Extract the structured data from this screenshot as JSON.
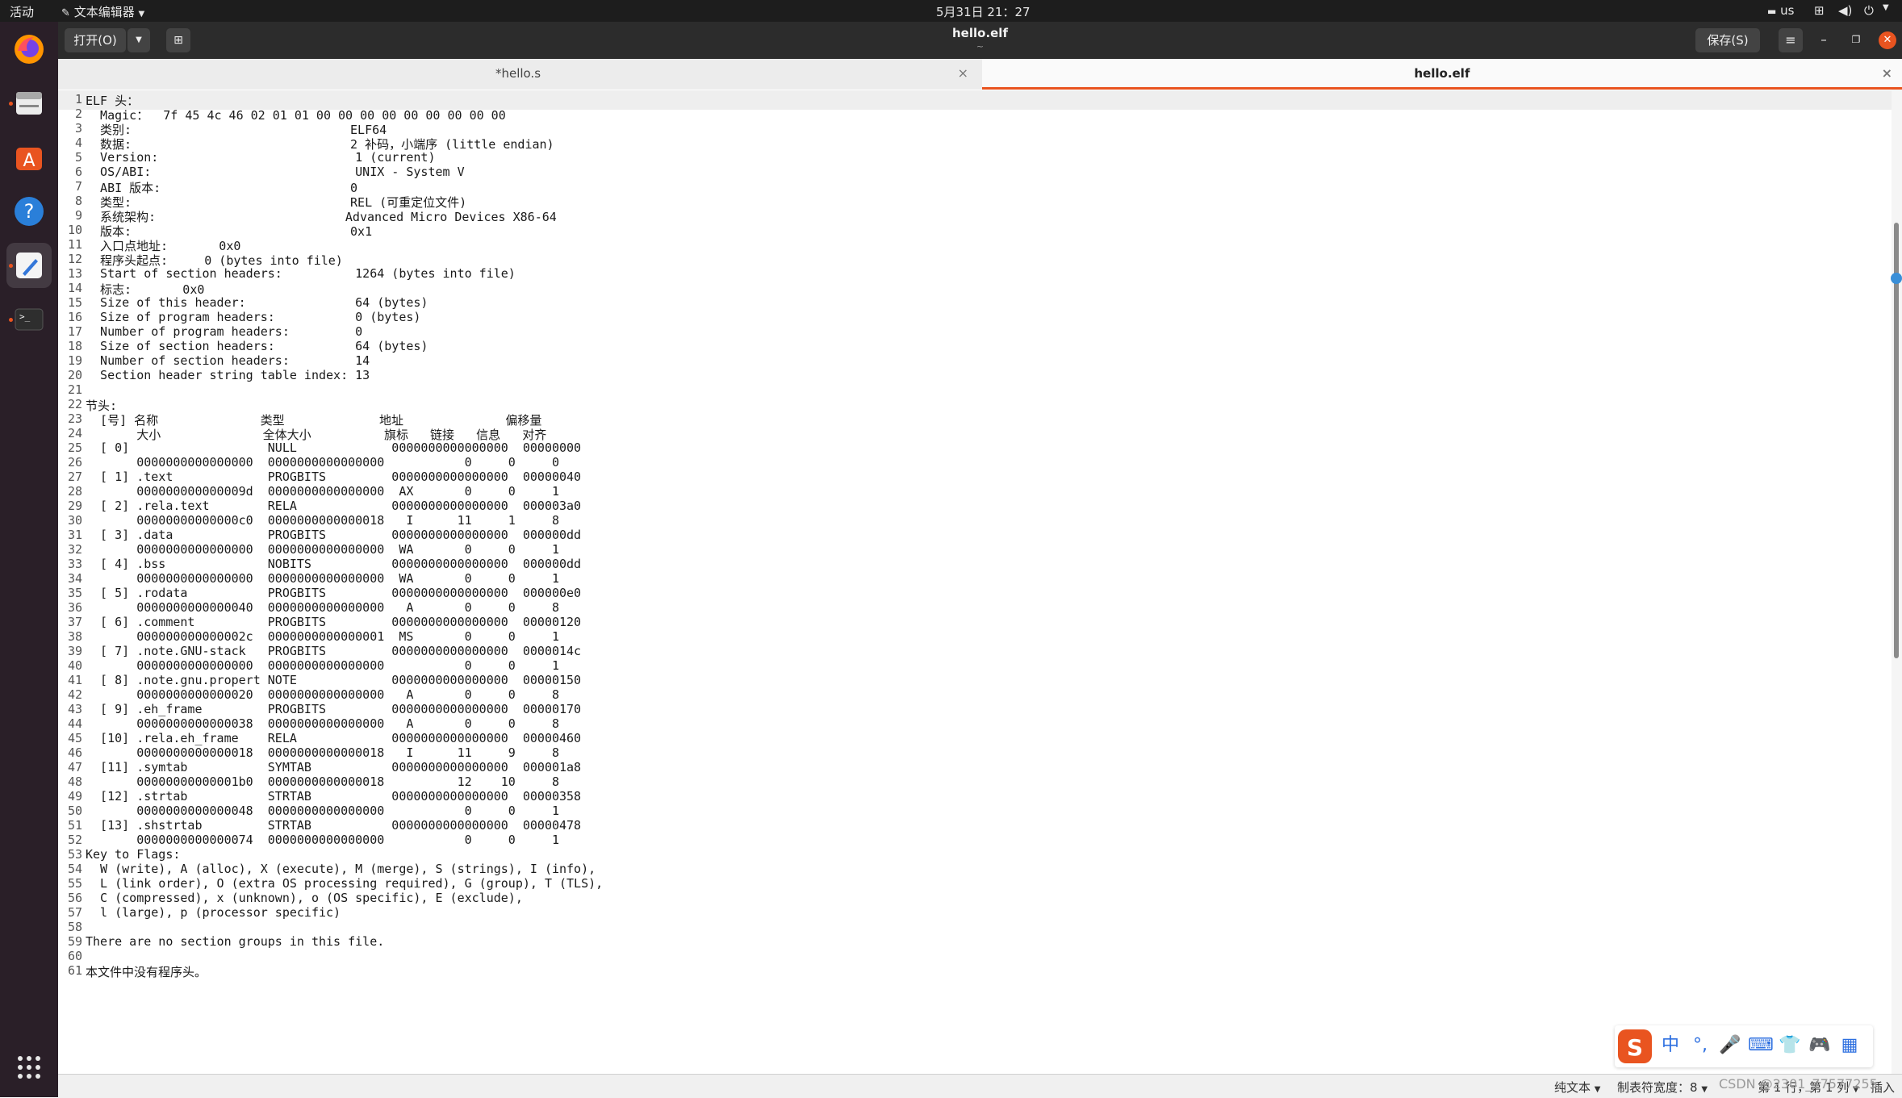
{
  "topbar": {
    "activities": "活动",
    "app_menu": "文本编辑器",
    "clock": "5月31日  21：27",
    "keyboard": "us"
  },
  "headerbar": {
    "open_label": "打开(O)",
    "title": "hello.elf",
    "subtitle": "~",
    "save_label": "保存(S)"
  },
  "tabs": [
    {
      "label": "*hello.s",
      "close": "×"
    },
    {
      "label": "hello.elf",
      "close": "×"
    }
  ],
  "editor": {
    "lines": [
      {
        "n": "1",
        "t": "ELF 头："
      },
      {
        "n": "2",
        "t": "  Magic：  7f 45 4c 46 02 01 01 00 00 00 00 00 00 00 00 00"
      },
      {
        "n": "3",
        "t": "  类别:                              ELF64"
      },
      {
        "n": "4",
        "t": "  数据:                              2 补码，小端序 (little endian)"
      },
      {
        "n": "5",
        "t": "  Version:                           1 (current)"
      },
      {
        "n": "6",
        "t": "  OS/ABI:                            UNIX - System V"
      },
      {
        "n": "7",
        "t": "  ABI 版本:                          0"
      },
      {
        "n": "8",
        "t": "  类型:                              REL (可重定位文件)"
      },
      {
        "n": "9",
        "t": "  系统架构:                          Advanced Micro Devices X86-64"
      },
      {
        "n": "10",
        "t": "  版本:                              0x1"
      },
      {
        "n": "11",
        "t": "  入口点地址:       0x0"
      },
      {
        "n": "12",
        "t": "  程序头起点:     0 (bytes into file)"
      },
      {
        "n": "13",
        "t": "  Start of section headers:          1264 (bytes into file)"
      },
      {
        "n": "14",
        "t": "  标志:       0x0"
      },
      {
        "n": "15",
        "t": "  Size of this header:               64 (bytes)"
      },
      {
        "n": "16",
        "t": "  Size of program headers:           0 (bytes)"
      },
      {
        "n": "17",
        "t": "  Number of program headers:         0"
      },
      {
        "n": "18",
        "t": "  Size of section headers:           64 (bytes)"
      },
      {
        "n": "19",
        "t": "  Number of section headers:         14"
      },
      {
        "n": "20",
        "t": "  Section header string table index: 13"
      },
      {
        "n": "21",
        "t": ""
      },
      {
        "n": "22",
        "t": "节头:"
      },
      {
        "n": "23",
        "t": "  [号] 名称              类型             地址              偏移量"
      },
      {
        "n": "24",
        "t": "       大小              全体大小          旗标   链接   信息   对齐"
      },
      {
        "n": "25",
        "t": "  [ 0]                   NULL             0000000000000000  00000000"
      },
      {
        "n": "26",
        "t": "       0000000000000000  0000000000000000           0     0     0"
      },
      {
        "n": "27",
        "t": "  [ 1] .text             PROGBITS         0000000000000000  00000040"
      },
      {
        "n": "28",
        "t": "       000000000000009d  0000000000000000  AX       0     0     1"
      },
      {
        "n": "29",
        "t": "  [ 2] .rela.text        RELA             0000000000000000  000003a0"
      },
      {
        "n": "30",
        "t": "       00000000000000c0  0000000000000018   I      11     1     8"
      },
      {
        "n": "31",
        "t": "  [ 3] .data             PROGBITS         0000000000000000  000000dd"
      },
      {
        "n": "32",
        "t": "       0000000000000000  0000000000000000  WA       0     0     1"
      },
      {
        "n": "33",
        "t": "  [ 4] .bss              NOBITS           0000000000000000  000000dd"
      },
      {
        "n": "34",
        "t": "       0000000000000000  0000000000000000  WA       0     0     1"
      },
      {
        "n": "35",
        "t": "  [ 5] .rodata           PROGBITS         0000000000000000  000000e0"
      },
      {
        "n": "36",
        "t": "       0000000000000040  0000000000000000   A       0     0     8"
      },
      {
        "n": "37",
        "t": "  [ 6] .comment          PROGBITS         0000000000000000  00000120"
      },
      {
        "n": "38",
        "t": "       000000000000002c  0000000000000001  MS       0     0     1"
      },
      {
        "n": "39",
        "t": "  [ 7] .note.GNU-stack   PROGBITS         0000000000000000  0000014c"
      },
      {
        "n": "40",
        "t": "       0000000000000000  0000000000000000           0     0     1"
      },
      {
        "n": "41",
        "t": "  [ 8] .note.gnu.propert NOTE             0000000000000000  00000150"
      },
      {
        "n": "42",
        "t": "       0000000000000020  0000000000000000   A       0     0     8"
      },
      {
        "n": "43",
        "t": "  [ 9] .eh_frame         PROGBITS         0000000000000000  00000170"
      },
      {
        "n": "44",
        "t": "       0000000000000038  0000000000000000   A       0     0     8"
      },
      {
        "n": "45",
        "t": "  [10] .rela.eh_frame    RELA             0000000000000000  00000460"
      },
      {
        "n": "46",
        "t": "       0000000000000018  0000000000000018   I      11     9     8"
      },
      {
        "n": "47",
        "t": "  [11] .symtab           SYMTAB           0000000000000000  000001a8"
      },
      {
        "n": "48",
        "t": "       00000000000001b0  0000000000000018          12    10     8"
      },
      {
        "n": "49",
        "t": "  [12] .strtab           STRTAB           0000000000000000  00000358"
      },
      {
        "n": "50",
        "t": "       0000000000000048  0000000000000000           0     0     1"
      },
      {
        "n": "51",
        "t": "  [13] .shstrtab         STRTAB           0000000000000000  00000478"
      },
      {
        "n": "52",
        "t": "       0000000000000074  0000000000000000           0     0     1"
      },
      {
        "n": "53",
        "t": "Key to Flags:"
      },
      {
        "n": "54",
        "t": "  W (write), A (alloc), X (execute), M (merge), S (strings), I (info),"
      },
      {
        "n": "55",
        "t": "  L (link order), O (extra OS processing required), G (group), T (TLS),"
      },
      {
        "n": "56",
        "t": "  C (compressed), x (unknown), o (OS specific), E (exclude),"
      },
      {
        "n": "57",
        "t": "  l (large), p (processor specific)"
      },
      {
        "n": "58",
        "t": ""
      },
      {
        "n": "59",
        "t": "There are no section groups in this file."
      },
      {
        "n": "60",
        "t": ""
      },
      {
        "n": "61",
        "t": "本文件中没有程序头。"
      }
    ]
  },
  "statusbar": {
    "mode": "纯文本",
    "tab_width": "制表符宽度：8",
    "position": "第 1 行，第 1 列",
    "insert": "插入"
  },
  "ime": {
    "items": [
      "中",
      "°,",
      "🎤",
      "⌨",
      "👕",
      "🎮",
      "▦"
    ]
  },
  "watermark": "CSDN @2301_77577255",
  "colors": {
    "accent": "#e95420",
    "topbar": "#1d1d1d",
    "dock": "#2a1f28",
    "headerbar": "#2c2c2c"
  }
}
